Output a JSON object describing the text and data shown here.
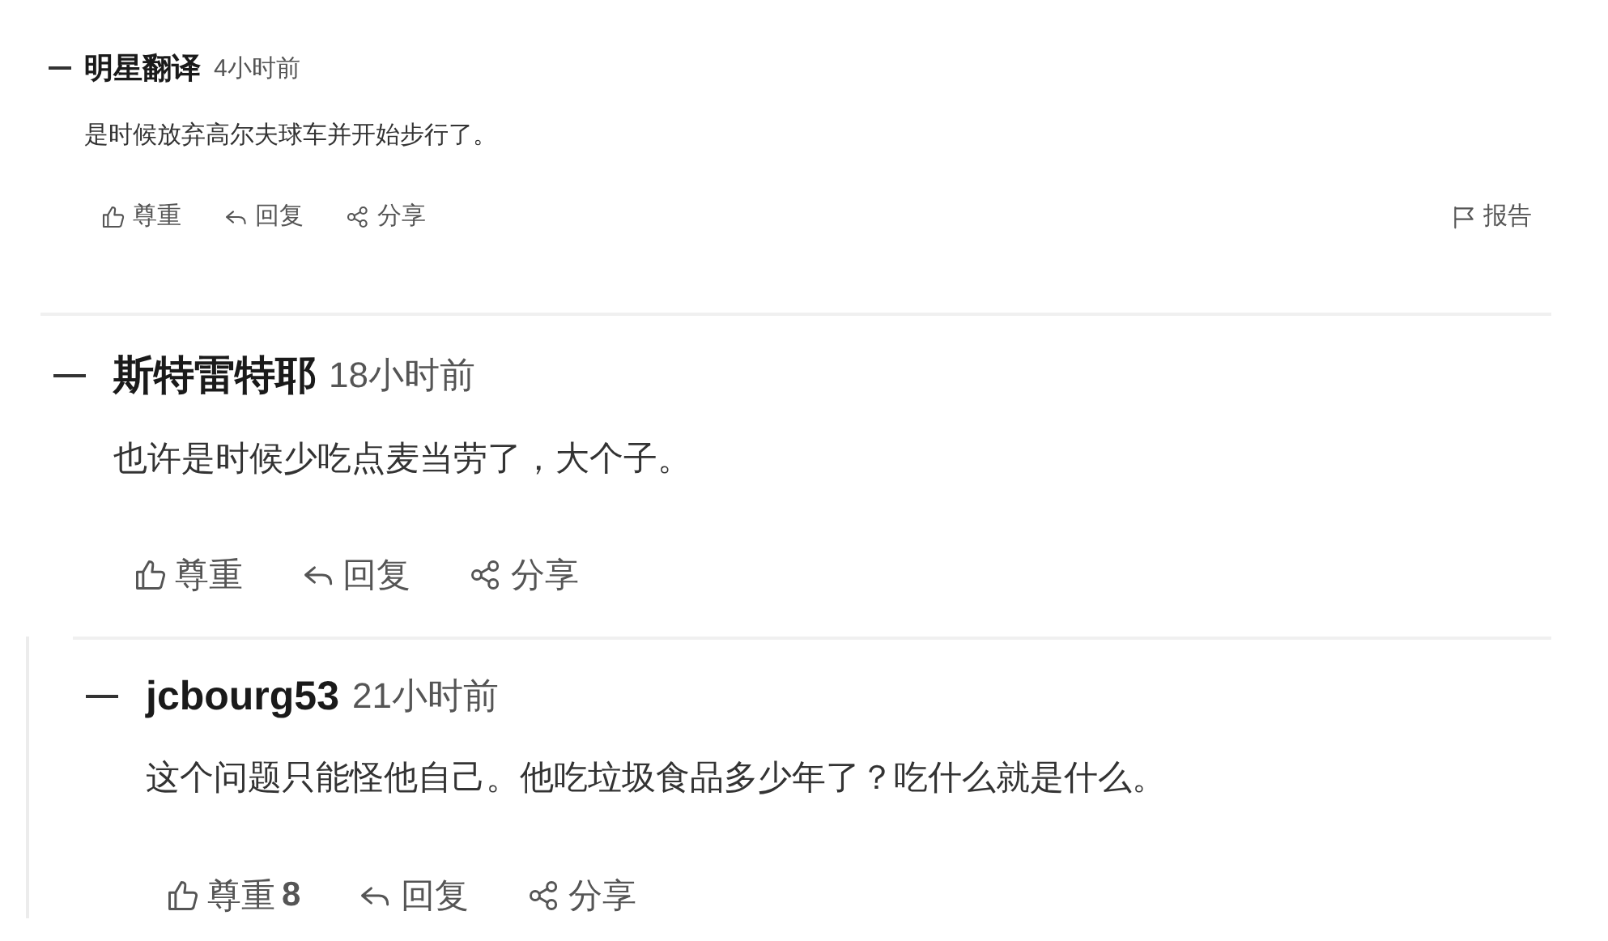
{
  "comments": [
    {
      "author": "明星翻译",
      "time": "4小时前",
      "body": "是时候放弃高尔夫球车并开始步行了。",
      "actions": [
        {
          "kind": "like",
          "label": "尊重"
        },
        {
          "kind": "reply",
          "label": "回复"
        },
        {
          "kind": "share",
          "label": "分享"
        }
      ],
      "report": "报告"
    },
    {
      "author": "斯特雷特耶",
      "time": "18小时前",
      "body": "也许是时候少吃点麦当劳了，大个子。",
      "actions": [
        {
          "kind": "like",
          "label": "尊重"
        },
        {
          "kind": "reply",
          "label": "回复"
        },
        {
          "kind": "share",
          "label": "分享"
        }
      ],
      "children": [
        {
          "author": "jcbourg53",
          "time": "21小时前",
          "body": "这个问题只能怪他自己。他吃垃圾食品多少年了？吃什么就是什么。",
          "actions": [
            {
              "kind": "like",
              "label": "尊重",
              "count": "8"
            },
            {
              "kind": "reply",
              "label": "回复"
            },
            {
              "kind": "share",
              "label": "分享"
            }
          ]
        }
      ]
    }
  ]
}
